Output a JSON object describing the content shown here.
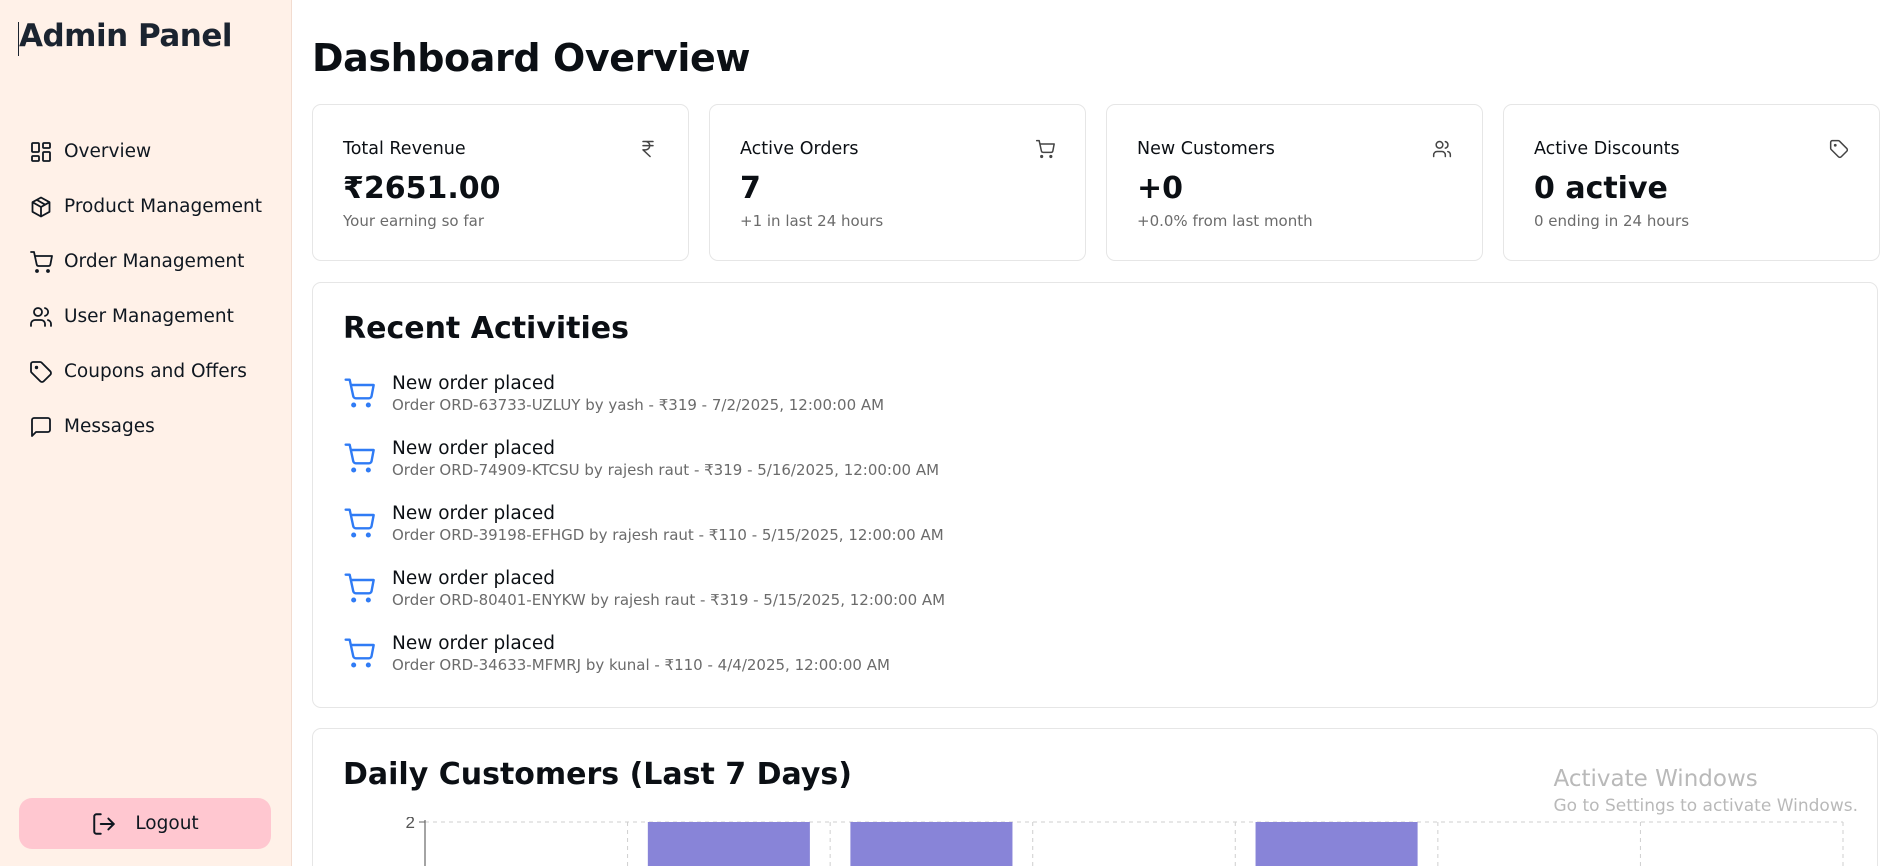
{
  "sidebar": {
    "brand": "Admin Panel",
    "items": [
      {
        "label": "Overview",
        "icon": "grid-icon"
      },
      {
        "label": "Product Management",
        "icon": "package-icon"
      },
      {
        "label": "Order Management",
        "icon": "cart-icon"
      },
      {
        "label": "User Management",
        "icon": "users-icon"
      },
      {
        "label": "Coupons and Offers",
        "icon": "tag-icon"
      },
      {
        "label": "Messages",
        "icon": "message-icon"
      }
    ],
    "logout_label": "Logout"
  },
  "main": {
    "title": "Dashboard Overview",
    "stats": [
      {
        "title": "Total Revenue",
        "value": "₹2651.00",
        "sub": "Your earning so far",
        "icon": "rupee-icon"
      },
      {
        "title": "Active Orders",
        "value": "7",
        "sub": "+1 in last 24 hours",
        "icon": "cart-icon"
      },
      {
        "title": "New Customers",
        "value": "+0",
        "sub": "+0.0% from last month",
        "icon": "users-icon"
      },
      {
        "title": "Active Discounts",
        "value": "0 active",
        "sub": "0 ending in 24 hours",
        "icon": "tag-icon"
      }
    ],
    "recent": {
      "title": "Recent Activities",
      "items": [
        {
          "title": "New order placed",
          "desc": "Order ORD-63733-UZLUY by yash - ₹319 - 7/2/2025, 12:00:00 AM"
        },
        {
          "title": "New order placed",
          "desc": "Order ORD-74909-KTCSU by rajesh raut - ₹319 - 5/16/2025, 12:00:00 AM"
        },
        {
          "title": "New order placed",
          "desc": "Order ORD-39198-EFHGD by rajesh raut - ₹110 - 5/15/2025, 12:00:00 AM"
        },
        {
          "title": "New order placed",
          "desc": "Order ORD-80401-ENYKW by rajesh raut - ₹319 - 5/15/2025, 12:00:00 AM"
        },
        {
          "title": "New order placed",
          "desc": "Order ORD-34633-MFMRJ by kunal - ₹110 - 4/4/2025, 12:00:00 AM"
        }
      ]
    },
    "daily": {
      "title": "Daily Customers (Last 7 Days)"
    }
  },
  "chart_data": {
    "type": "bar",
    "title": "Daily Customers (Last 7 Days)",
    "y_ticks_visible": [
      "2"
    ],
    "values": [
      0,
      2,
      2,
      0,
      2,
      0,
      0
    ],
    "grid": true,
    "bar_color": "#8884d8"
  },
  "watermark": {
    "line1": "Activate Windows",
    "line2": "Go to Settings to activate Windows."
  },
  "colors": {
    "sidebar_bg": "#fff1e8",
    "logout_bg": "#ffc7d0",
    "activity_icon": "#2f7bf5",
    "bar": "#8884d8"
  }
}
